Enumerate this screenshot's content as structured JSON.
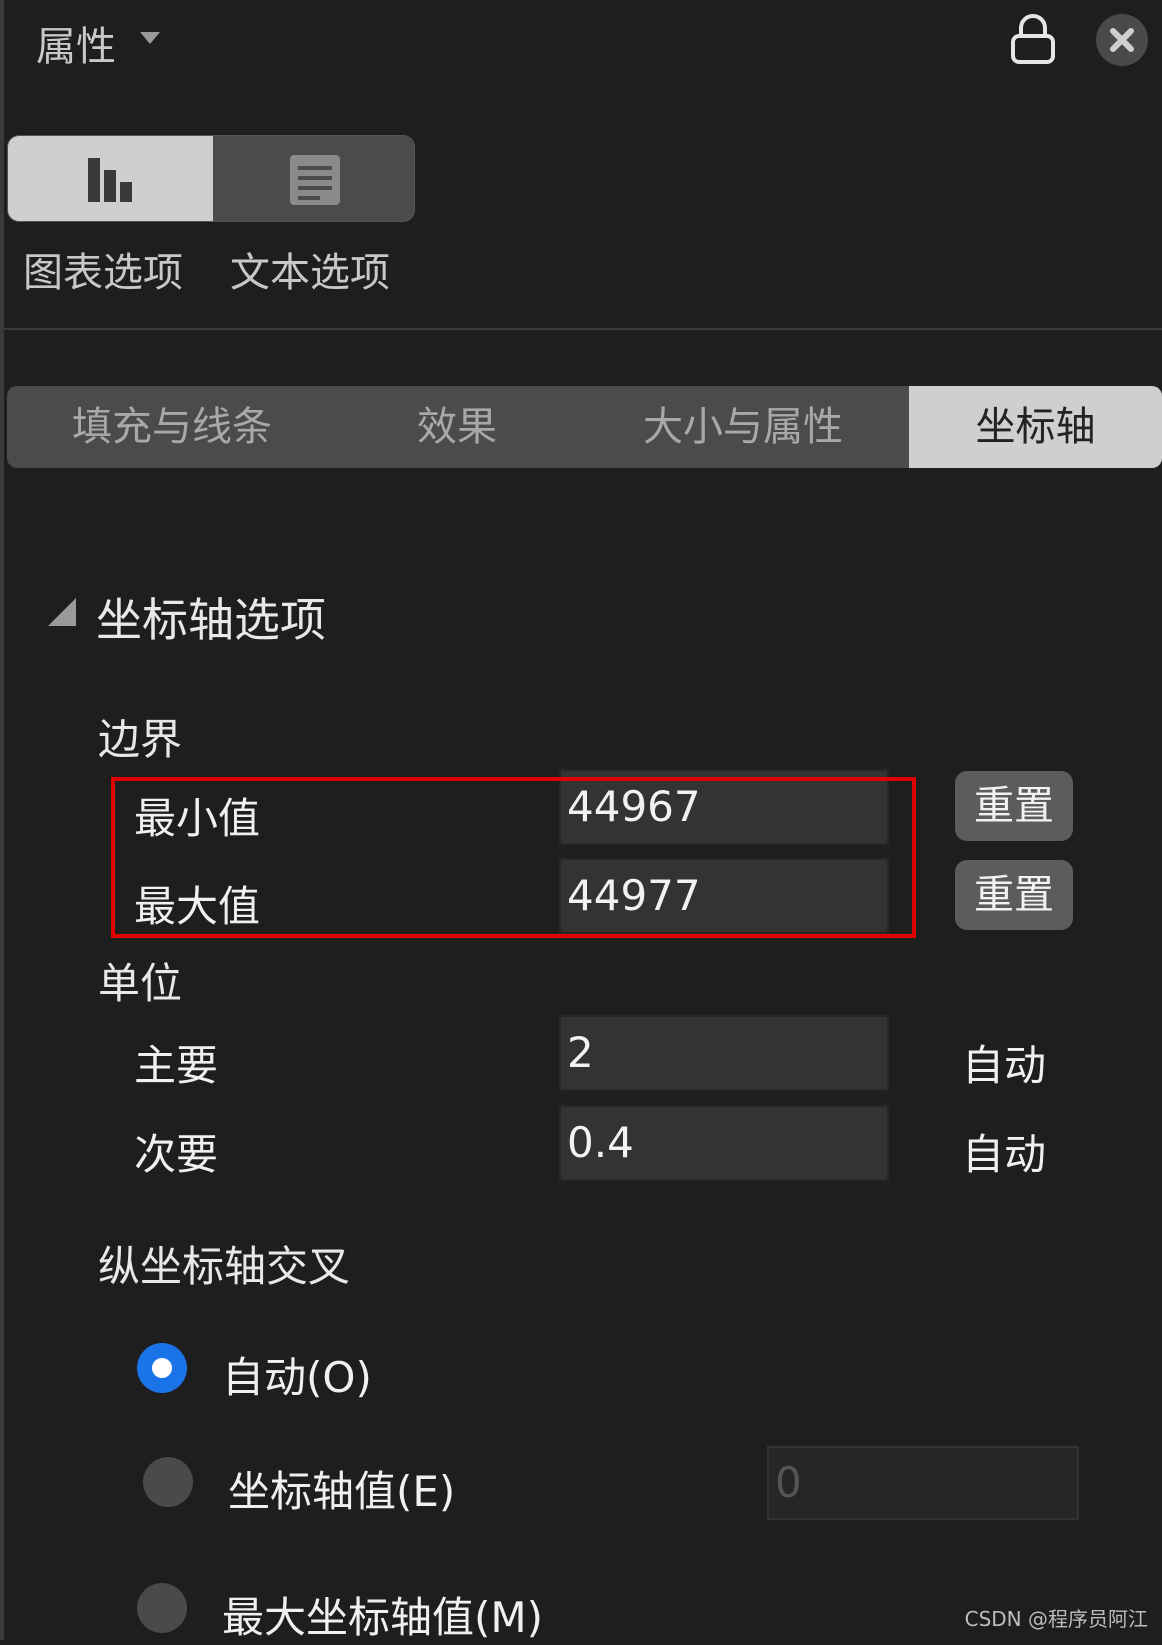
{
  "header": {
    "title": "属性"
  },
  "panel_switch": {
    "chart_options_label": "图表选项",
    "text_options_label": "文本选项"
  },
  "tabs": [
    {
      "label": "填充与线条",
      "active": false
    },
    {
      "label": "效果",
      "active": false
    },
    {
      "label": "大小与属性",
      "active": false
    },
    {
      "label": "坐标轴",
      "active": true
    }
  ],
  "axis_options": {
    "title": "坐标轴选项",
    "bounds": {
      "heading": "边界",
      "min_label": "最小值",
      "min_value": "44967",
      "max_label": "最大值",
      "max_value": "44977",
      "reset_label": "重置"
    },
    "units": {
      "heading": "单位",
      "major_label": "主要",
      "major_value": "2",
      "minor_label": "次要",
      "minor_value": "0.4",
      "auto_label": "自动"
    },
    "cross": {
      "heading": "纵坐标轴交叉",
      "options": [
        {
          "label": "自动(O)",
          "checked": true
        },
        {
          "label": "坐标轴值(E)",
          "checked": false
        },
        {
          "label": "最大坐标轴值(M)",
          "checked": false
        }
      ],
      "axis_value": "0"
    }
  },
  "colors": {
    "accent": "#1a74e8",
    "highlight": "#e00000",
    "background": "#1e1e1e"
  },
  "watermark": "CSDN @程序员阿江"
}
